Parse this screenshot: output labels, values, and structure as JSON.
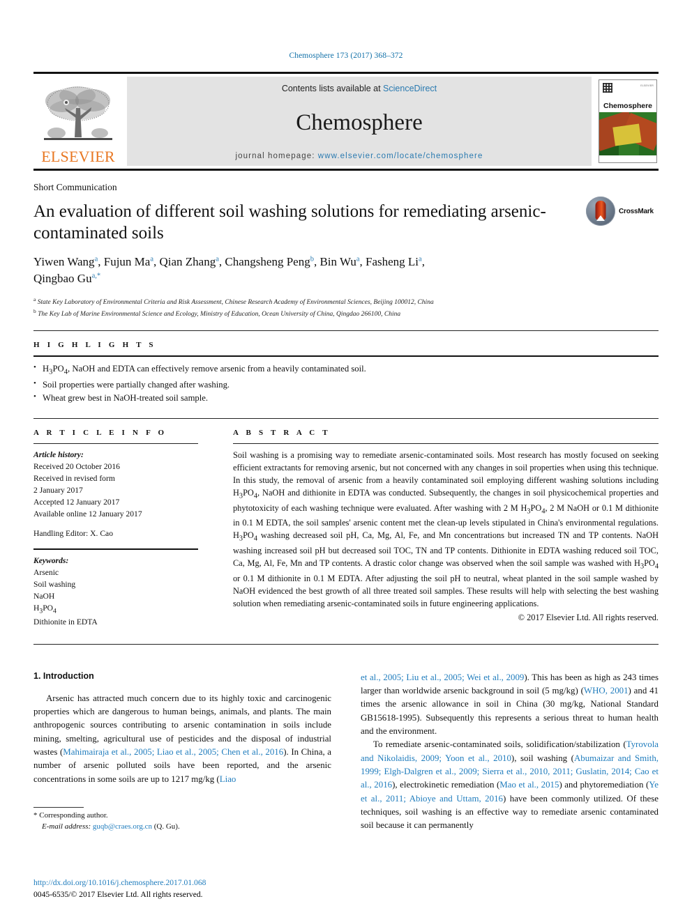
{
  "running_head": "Chemosphere 173 (2017) 368–372",
  "masthead": {
    "contents_prefix": "Contents lists available at ",
    "sciencedirect": "ScienceDirect",
    "journal_name": "Chemosphere",
    "homepage_prefix": "journal homepage: ",
    "homepage_url": "www.elsevier.com/locate/chemosphere",
    "publisher": "ELSEVIER",
    "cover_title": "Chemosphere",
    "cover_tiny": "ELSEVIER"
  },
  "article": {
    "category": "Short Communication",
    "title": "An evaluation of different soil washing solutions for remediating arsenic-contaminated soils",
    "crossmark_label": "CrossMark",
    "affiliation_a": "State Key Laboratory of Environmental Criteria and Risk Assessment, Chinese Research Academy of Environmental Sciences, Beijing 100012, China",
    "affiliation_b": "The Key Lab of Marine Environmental Science and Ecology, Ministry of Education, Ocean University of China, Qingdao 266100, China"
  },
  "authors": [
    {
      "name": "Yiwen Wang",
      "marks": "a",
      "star": false
    },
    {
      "name": "Fujun Ma",
      "marks": "a",
      "star": false
    },
    {
      "name": "Qian Zhang",
      "marks": "a",
      "star": false
    },
    {
      "name": "Changsheng Peng",
      "marks": "b",
      "star": false
    },
    {
      "name": "Bin Wu",
      "marks": "a",
      "star": false
    },
    {
      "name": "Fasheng Li",
      "marks": "a",
      "star": false
    },
    {
      "name": "Qingbao Gu",
      "marks": "a",
      "star": true
    }
  ],
  "highlights": {
    "label": "H I G H L I G H T S",
    "items": [
      "H3PO4, NaOH and EDTA can effectively remove arsenic from a heavily contaminated soil.",
      "Soil properties were partially changed after washing.",
      "Wheat grew best in NaOH-treated soil sample."
    ]
  },
  "article_info": {
    "label": "A R T I C L E  I N F O",
    "history_label": "Article history:",
    "received": "Received 20 October 2016",
    "revised_label": "Received in revised form",
    "revised_date": "2 January 2017",
    "accepted": "Accepted 12 January 2017",
    "available": "Available online 12 January 2017",
    "handling_editor": "Handling Editor: X. Cao",
    "keywords_label": "Keywords:",
    "keywords": [
      "Arsenic",
      "Soil washing",
      "NaOH",
      "H3PO4",
      "Dithionite in EDTA"
    ]
  },
  "abstract": {
    "label": "A B S T R A C T",
    "text": "Soil washing is a promising way to remediate arsenic-contaminated soils. Most research has mostly focused on seeking efficient extractants for removing arsenic, but not concerned with any changes in soil properties when using this technique. In this study, the removal of arsenic from a heavily contaminated soil employing different washing solutions including H3PO4, NaOH and dithionite in EDTA was conducted. Subsequently, the changes in soil physicochemical properties and phytotoxicity of each washing technique were evaluated. After washing with 2 M H3PO4, 2 M NaOH or 0.1 M dithionite in 0.1 M EDTA, the soil samples' arsenic content met the clean-up levels stipulated in China's environmental regulations. H3PO4 washing decreased soil pH, Ca, Mg, Al, Fe, and Mn concentrations but increased TN and TP contents. NaOH washing increased soil pH but decreased soil TOC, TN and TP contents. Dithionite in EDTA washing reduced soil TOC, Ca, Mg, Al, Fe, Mn and TP contents. A drastic color change was observed when the soil sample was washed with H3PO4 or 0.1 M dithionite in 0.1 M EDTA. After adjusting the soil pH to neutral, wheat planted in the soil sample washed by NaOH evidenced the best growth of all three treated soil samples. These results will help with selecting the best washing solution when remediating arsenic-contaminated soils in future engineering applications.",
    "copyright": "© 2017 Elsevier Ltd. All rights reserved."
  },
  "introduction": {
    "heading": "1. Introduction",
    "left_paragraph_pre": "Arsenic has attracted much concern due to its highly toxic and carcinogenic properties which are dangerous to human beings, animals, and plants. The main anthropogenic sources contributing to arsenic contamination in soils include mining, smelting, agricultural use of pesticides and the disposal of industrial wastes (",
    "left_ref_1": "Mahimairaja et al., 2005; Liao et al., 2005; Chen et al., 2016",
    "left_paragraph_mid": "). In China, a number of arsenic polluted soils have been reported, and the arsenic concentrations in some soils are up to 1217 mg/kg (",
    "left_ref_2": "Liao",
    "right_ref_2_cont": "et al., 2005; Liu et al., 2005; Wei et al., 2009",
    "right_paragraph_a_mid": "). This has been as high as 243 times larger than worldwide arsenic background in soil (5 mg/kg) (",
    "right_ref_3": "WHO, 2001",
    "right_paragraph_a_end": ") and 41 times the arsenic allowance in soil in China (30 mg/kg, National Standard GB15618-1995). Subsequently this represents a serious threat to human health and the environment.",
    "right_paragraph_b_pre": "To remediate arsenic-contaminated soils, solidification/stabilization (",
    "right_ref_4": "Tyrovola and Nikolaidis, 2009; Yoon et al., 2010",
    "right_p_b_1": "), soil washing (",
    "right_ref_5": "Abumaizar and Smith, 1999; Elgh-Dalgren et al., 2009; Sierra et al., 2010, 2011; Guslatin, 2014; Cao et al., 2016",
    "right_p_b_2": "), electrokinetic remediation (",
    "right_ref_6": "Mao et al., 2015",
    "right_p_b_3": ") and phytoremediation (",
    "right_ref_7": "Ye et al., 2011; Abioye and Uttam, 2016",
    "right_p_b_4": ") have been commonly utilized. Of these techniques, soil washing is an effective way to remediate arsenic contaminated soil because it can permanently"
  },
  "footnote": {
    "star": "*",
    "corresponding": "Corresponding author.",
    "email_label": "E-mail address:",
    "email": "guqb@craes.org.cn",
    "email_suffix": "(Q. Gu)."
  },
  "page_footer": {
    "doi": "http://dx.doi.org/10.1016/j.chemosphere.2017.01.068",
    "issn_line": "0045-6535/© 2017 Elsevier Ltd. All rights reserved."
  },
  "colors": {
    "link": "#1f7cbd",
    "running_head": "#1070a8",
    "elsevier_orange": "#E87722",
    "masthead_bg": "#e3e3e3"
  }
}
